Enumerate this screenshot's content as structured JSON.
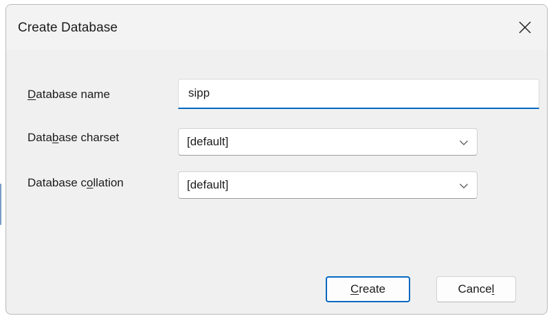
{
  "window": {
    "title": "Create Database",
    "close_icon": "close-icon"
  },
  "form": {
    "name": {
      "label_pre": "",
      "label_key": "D",
      "label_post": "atabase name",
      "value": "sipp"
    },
    "charset": {
      "label_pre": "Data",
      "label_key": "b",
      "label_post": "ase charset",
      "value": "[default]",
      "arrow_icon": "chevron-down-icon"
    },
    "collation": {
      "label_pre": "Database c",
      "label_key": "o",
      "label_post": "llation",
      "value": "[default]",
      "arrow_icon": "chevron-down-icon"
    }
  },
  "buttons": {
    "create": {
      "pre": "",
      "key": "C",
      "post": "reate"
    },
    "cancel": {
      "pre": "Cance",
      "key": "l",
      "post": ""
    }
  },
  "colors": {
    "accent": "#0067c0",
    "dialog_bg": "#f0f0f0",
    "text": "#1b1b1b"
  }
}
